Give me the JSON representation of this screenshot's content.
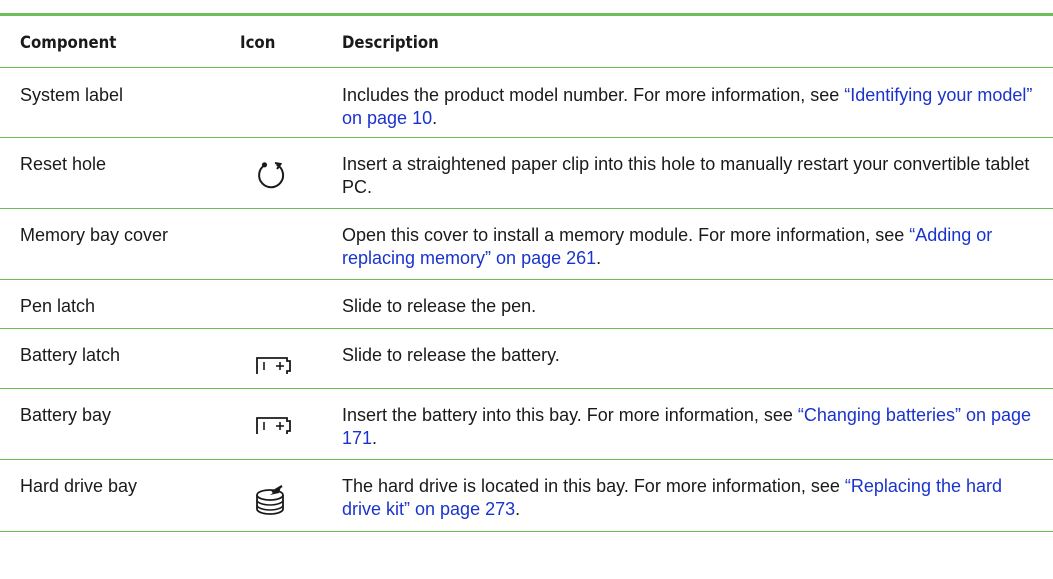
{
  "header": {
    "component": "Component",
    "icon": "Icon",
    "description": "Description"
  },
  "rows": [
    {
      "component": "System label",
      "icon": "",
      "description": "Includes the product model number. For more information, see ",
      "link": "“Identifying your model” on page 10",
      "suffix": "."
    },
    {
      "component": "Reset hole",
      "icon": "reset-icon",
      "description": "Insert a straightened paper clip into this hole to manually restart your convertible tablet PC.",
      "link": "",
      "suffix": ""
    },
    {
      "component": "Memory bay cover",
      "icon": "",
      "description": "Open this cover to install a memory module. For more information, see ",
      "link": "“Adding or replacing memory” on page 261",
      "suffix": "."
    },
    {
      "component": "Pen latch",
      "icon": "",
      "description": "Slide to release the pen.",
      "link": "",
      "suffix": ""
    },
    {
      "component": "Battery latch",
      "icon": "battery-icon",
      "description": "Slide to release the battery.",
      "link": "",
      "suffix": ""
    },
    {
      "component": "Battery bay",
      "icon": "battery-icon",
      "description": "Insert the battery into this bay. For more information, see ",
      "link": "“Changing batteries” on page 171",
      "suffix": "."
    },
    {
      "component": "Hard drive bay",
      "icon": "hard-drive-icon",
      "description": "The hard drive is located in this bay. For more information, see ",
      "link": "“Replacing the hard drive kit” on page 273",
      "suffix": "."
    }
  ]
}
